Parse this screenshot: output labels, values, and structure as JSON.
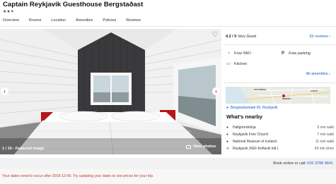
{
  "header": {
    "title": "Captain Reykjavík Guesthouse Bergstaðast",
    "stars": "★★✦"
  },
  "tabs": [
    {
      "label": "Overview"
    },
    {
      "label": "Rooms"
    },
    {
      "label": "Location"
    },
    {
      "label": "Amenities"
    },
    {
      "label": "Policies"
    },
    {
      "label": "Reviews"
    }
  ],
  "gallery": {
    "counter": "1 / 10 - Featured image",
    "view_photos": "View photos",
    "prev_icon": "‹",
    "next_icon": "›",
    "heart_icon": "♡"
  },
  "rating": {
    "score": "4.2 / 5",
    "label": "Very Good",
    "reviews_link": "25 reviews ›"
  },
  "amenities": {
    "wifi": "Free WiFi",
    "parking": "Free parking",
    "kitchen": "Kitchen",
    "all_link": "All amenities ›"
  },
  "map": {
    "labels": [
      "VESTURBÆR",
      "MIÐBORG",
      "HLÍÐAR"
    ]
  },
  "address": "Bergstaðastræti 60, Reykjavik",
  "nearby": {
    "heading": "What's nearby",
    "places": [
      {
        "name": "Hallgrimskirkja",
        "distance": "5 min walk",
        "icon": "pin"
      },
      {
        "name": "Reykjavik Free Church",
        "distance": "7 min walk",
        "icon": "pin"
      },
      {
        "name": "National Museum of Iceland",
        "distance": "11 min walk",
        "icon": "pin"
      },
      {
        "name": "Reykjavik (KEF-Keflavik Intl.)",
        "distance": "43 min drive",
        "icon": "plane"
      }
    ]
  },
  "booking": {
    "text": "Book online or call:",
    "phone": "020 3788 4841"
  },
  "notice": "Your dates need to occur after 2019-12-09. Try updating your dates to see prices for your trip.",
  "colors": {
    "brand_red": "#c4162a",
    "link_blue": "#1a5fc7",
    "notice_red": "#c0392b"
  }
}
